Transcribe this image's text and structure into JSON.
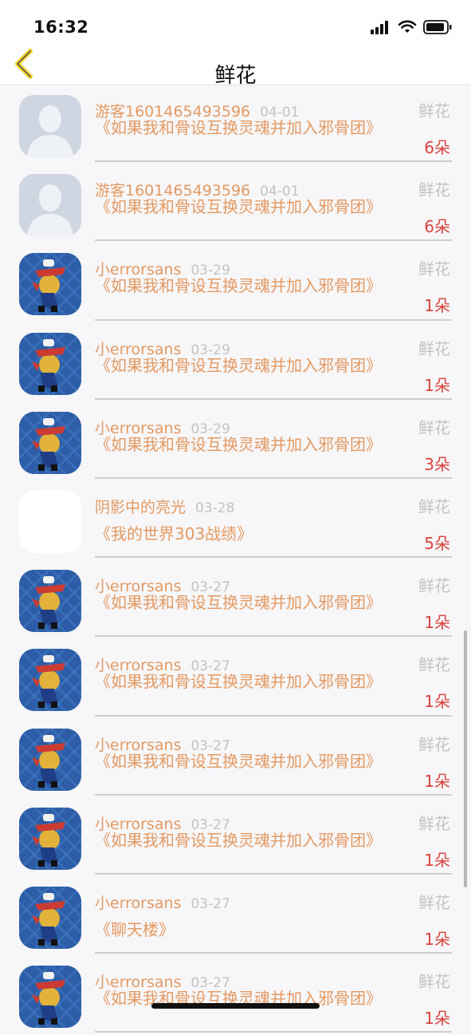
{
  "status_bar": {
    "time": "16:32",
    "icons": [
      "signal-icon",
      "wifi-icon",
      "battery-icon"
    ]
  },
  "header": {
    "title": "鲜花",
    "back_icon": "chevron-left-icon"
  },
  "rows": [
    {
      "avatar": "guest",
      "name": "游客1601465493596",
      "date": "04-01",
      "book": "《如果我和骨设互换灵魂并加入邪骨团》",
      "type": "鲜花",
      "count": "6朵"
    },
    {
      "avatar": "guest",
      "name": "游客1601465493596",
      "date": "04-01",
      "book": "《如果我和骨设互换灵魂并加入邪骨团》",
      "type": "鲜花",
      "count": "6朵"
    },
    {
      "avatar": "char",
      "name": "小errorsans",
      "date": "03-29",
      "book": "《如果我和骨设互换灵魂并加入邪骨团》",
      "type": "鲜花",
      "count": "1朵"
    },
    {
      "avatar": "char",
      "name": "小errorsans",
      "date": "03-29",
      "book": "《如果我和骨设互换灵魂并加入邪骨团》",
      "type": "鲜花",
      "count": "1朵"
    },
    {
      "avatar": "char",
      "name": "小errorsans",
      "date": "03-29",
      "book": "《如果我和骨设互换灵魂并加入邪骨团》",
      "type": "鲜花",
      "count": "3朵"
    },
    {
      "avatar": "blank",
      "name": "阴影中的亮光",
      "date": "03-28",
      "book": "《我的世界303战绩》",
      "type": "鲜花",
      "count": "5朵"
    },
    {
      "avatar": "char",
      "name": "小errorsans",
      "date": "03-27",
      "book": "《如果我和骨设互换灵魂并加入邪骨团》",
      "type": "鲜花",
      "count": "1朵"
    },
    {
      "avatar": "char",
      "name": "小errorsans",
      "date": "03-27",
      "book": "《如果我和骨设互换灵魂并加入邪骨团》",
      "type": "鲜花",
      "count": "1朵"
    },
    {
      "avatar": "char",
      "name": "小errorsans",
      "date": "03-27",
      "book": "《如果我和骨设互换灵魂并加入邪骨团》",
      "type": "鲜花",
      "count": "1朵"
    },
    {
      "avatar": "char",
      "name": "小errorsans",
      "date": "03-27",
      "book": "《如果我和骨设互换灵魂并加入邪骨团》",
      "type": "鲜花",
      "count": "1朵"
    },
    {
      "avatar": "char",
      "name": "小errorsans",
      "date": "03-27",
      "book": "《聊天楼》",
      "type": "鲜花",
      "count": "1朵"
    },
    {
      "avatar": "char",
      "name": "小errorsans",
      "date": "03-27",
      "book": "《如果我和骨设互换灵魂并加入邪骨团》",
      "type": "鲜花",
      "count": "1朵"
    }
  ],
  "colors": {
    "accent_orange": "#e39a63",
    "count_red": "#d9433e",
    "muted_gray": "#c3c3c3",
    "back_yellow": "#f1cf2c"
  }
}
